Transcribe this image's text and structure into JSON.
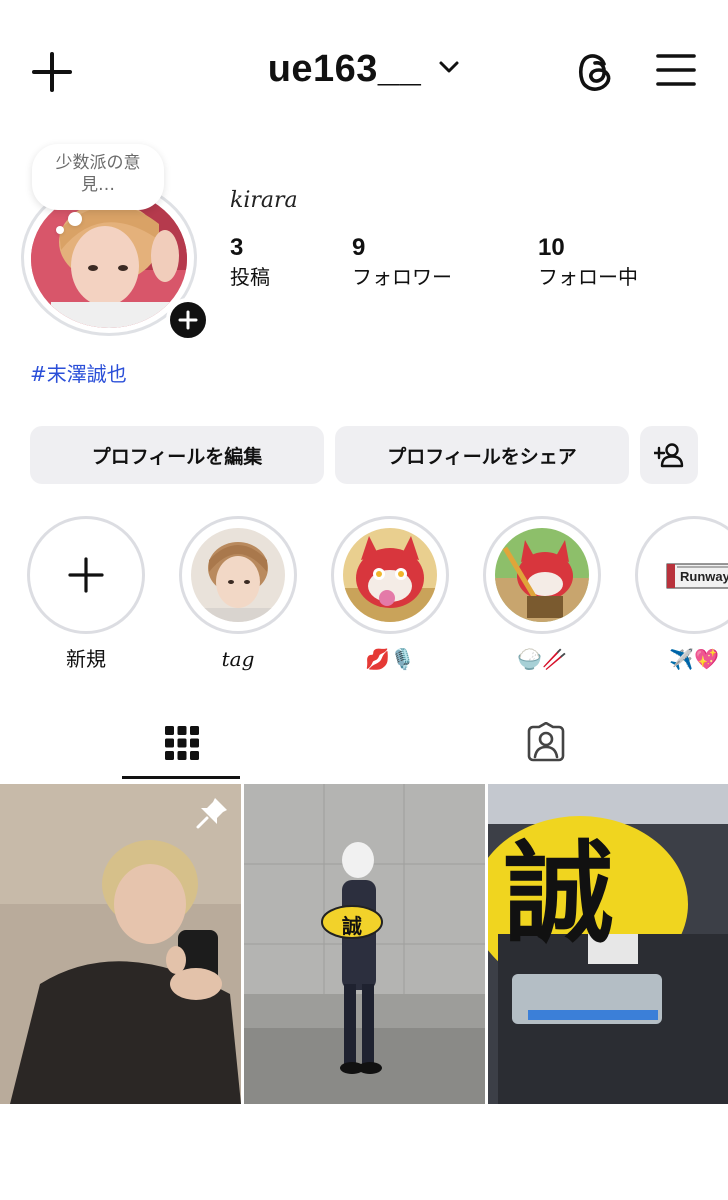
{
  "header": {
    "username": "ue163__",
    "icons": [
      "plus-icon",
      "chevron-down-icon",
      "threads-icon",
      "menu-icon"
    ]
  },
  "profile": {
    "note": [
      "少数派の意",
      "見…"
    ],
    "display_name": "kirara",
    "stats": [
      {
        "value": "3",
        "label": "投稿"
      },
      {
        "value": "9",
        "label": "フォロワー"
      },
      {
        "value": "10",
        "label": "フォロー中"
      }
    ],
    "hashtag": "#末澤誠也"
  },
  "actions": {
    "edit_label": "プロフィールを編集",
    "share_label": "プロフィールをシェア"
  },
  "highlights": [
    {
      "label": "新規"
    },
    {
      "label": "tag"
    },
    {
      "label": "💋🎙️"
    },
    {
      "label": "🍚🥢"
    },
    {
      "label": "✈️💖",
      "text": "Runway"
    }
  ],
  "posts": [
    {
      "pinned": true
    },
    {
      "sign_text": "誠"
    },
    {
      "sign_text": "誠"
    }
  ],
  "colors": {
    "link": "#2b4fd8",
    "button_bg": "#efeff2",
    "ring": "#dcdde2"
  }
}
